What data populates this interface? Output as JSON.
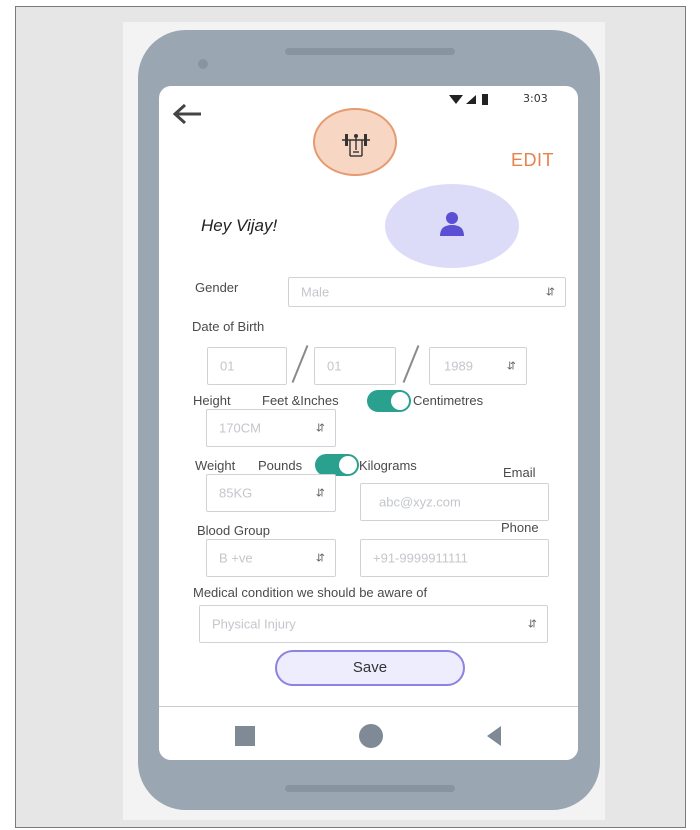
{
  "status_bar": {
    "time": "3:03"
  },
  "header": {
    "edit_label": "EDIT"
  },
  "profile": {
    "greeting": "Hey Vijay!"
  },
  "form": {
    "gender_label": "Gender",
    "gender_value": "Male",
    "dob_label": "Date of Birth",
    "dob_day": "01",
    "dob_month": "01",
    "dob_year": "1989",
    "height_label": "Height",
    "height_unit_left": "Feet &Inches",
    "height_unit_right": "Centimetres",
    "height_value": "170CM",
    "weight_label": "Weight",
    "weight_unit_left": "Pounds",
    "weight_unit_right": "Kilograms",
    "weight_value": "85KG",
    "email_label": "Email",
    "email_placeholder": "abc@xyz.com",
    "blood_group_label": "Blood Group",
    "blood_group_value": "B +ve",
    "phone_label": "Phone",
    "phone_placeholder": "+91-9999911111",
    "medical_label": "Medical condition we should be aware of",
    "medical_value": "Physical Injury",
    "save_label": "Save"
  },
  "colors": {
    "accent_orange": "#e8814c",
    "toggle_teal": "#2aa18e",
    "avatar_purple": "#5b4fd6",
    "save_border": "#8b82e2"
  },
  "icons": {
    "back": "arrow-left-icon",
    "logo": "gym-barbell-icon",
    "avatar": "user-icon",
    "nav_recent": "square-icon",
    "nav_home": "circle-icon",
    "nav_back": "triangle-back-icon"
  }
}
